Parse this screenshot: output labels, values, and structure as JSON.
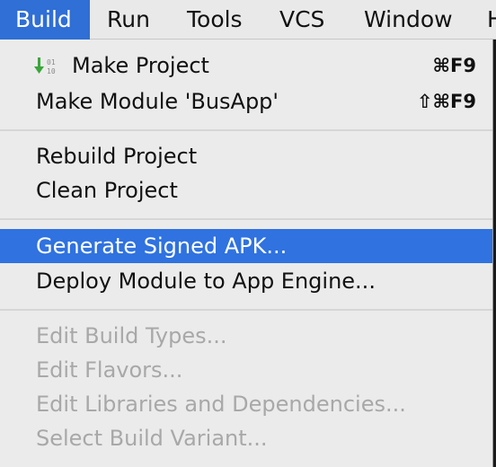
{
  "menubar": {
    "items": [
      {
        "label": "Build"
      },
      {
        "label": "Run"
      },
      {
        "label": "Tools"
      },
      {
        "label": "VCS"
      },
      {
        "label": "Window"
      },
      {
        "label": "H"
      }
    ]
  },
  "menu": {
    "make_project": {
      "label": "Make Project",
      "shortcut": "⌘F9",
      "icon": "make-build-icon"
    },
    "make_module": {
      "label": "Make Module 'BusApp'",
      "shortcut": "⇧⌘F9"
    },
    "rebuild_project": {
      "label": "Rebuild Project"
    },
    "clean_project": {
      "label": "Clean Project"
    },
    "generate_signed_apk": {
      "label": "Generate Signed APK..."
    },
    "deploy_module": {
      "label": "Deploy Module to App Engine..."
    },
    "edit_build_types": {
      "label": "Edit Build Types..."
    },
    "edit_flavors": {
      "label": "Edit Flavors..."
    },
    "edit_libraries": {
      "label": "Edit Libraries and Dependencies..."
    },
    "select_build_variant": {
      "label": "Select Build Variant..."
    }
  },
  "colors": {
    "highlight": "#2f72e0",
    "disabled_text": "#a8a8a8",
    "icon_arrow": "#3aa63a"
  }
}
